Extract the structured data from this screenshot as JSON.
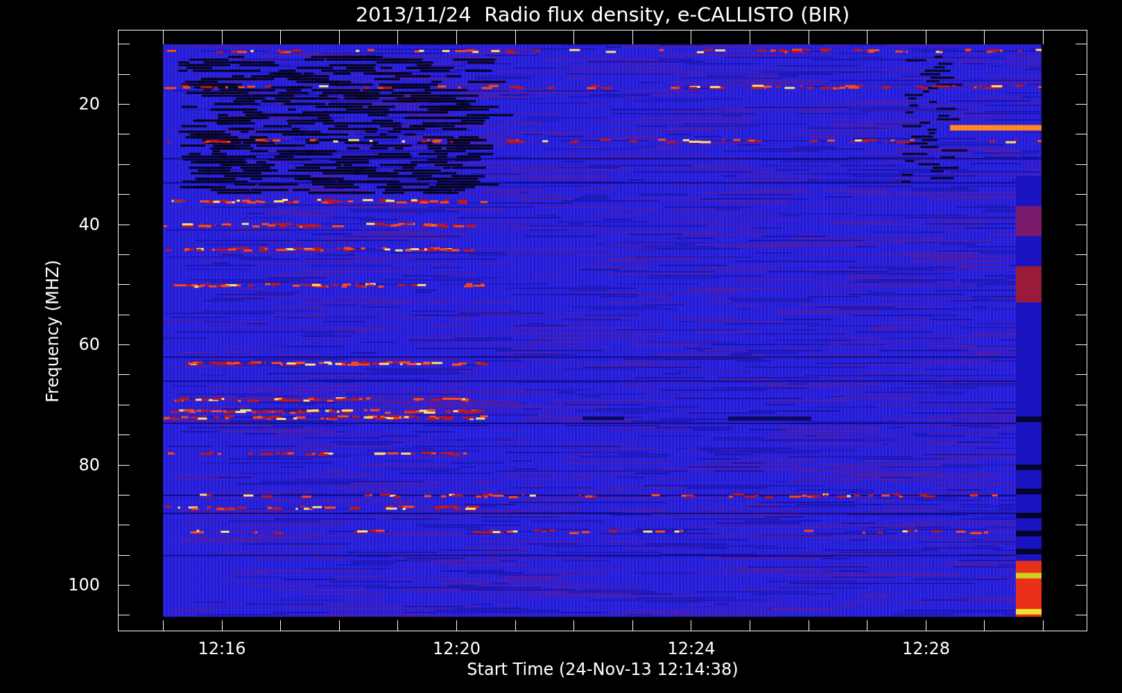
{
  "title": "2013/11/24  Radio flux density, e-CALLISTO (BIR)",
  "y_axis": {
    "label": "Frequency (MHZ)",
    "ticks": [
      "20",
      "40",
      "60",
      "80",
      "100"
    ]
  },
  "x_axis": {
    "label": "Start Time (24-Nov-13 12:14:38)",
    "ticks": [
      "12:16",
      "12:20",
      "12:24",
      "12:28"
    ]
  }
}
